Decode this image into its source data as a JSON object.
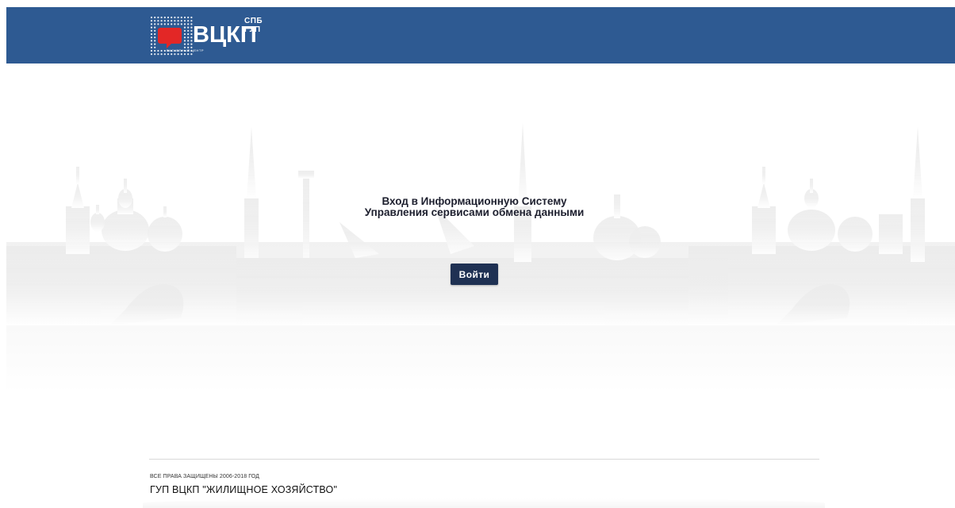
{
  "header": {
    "logo": {
      "top_text": "СПБ ГУП",
      "main_text": "ВЦКП",
      "sub_text": "РАСЧЕТНЫЙ ЦЕНТР"
    },
    "background_color": "#2e5a92"
  },
  "main": {
    "title_line1": "Вход в Информационную Систему",
    "title_line2": "Управления сервисами обмена данными",
    "login_button_label": "Войти",
    "button_color": "#1f3153"
  },
  "footer": {
    "copyright": "ВСЕ ПРАВА ЗАЩИЩЕНЫ 2006-2018 ГОД",
    "company": "ГУП ВЦКП \"ЖИЛИЩНОЕ ХОЗЯЙСТВО\""
  }
}
